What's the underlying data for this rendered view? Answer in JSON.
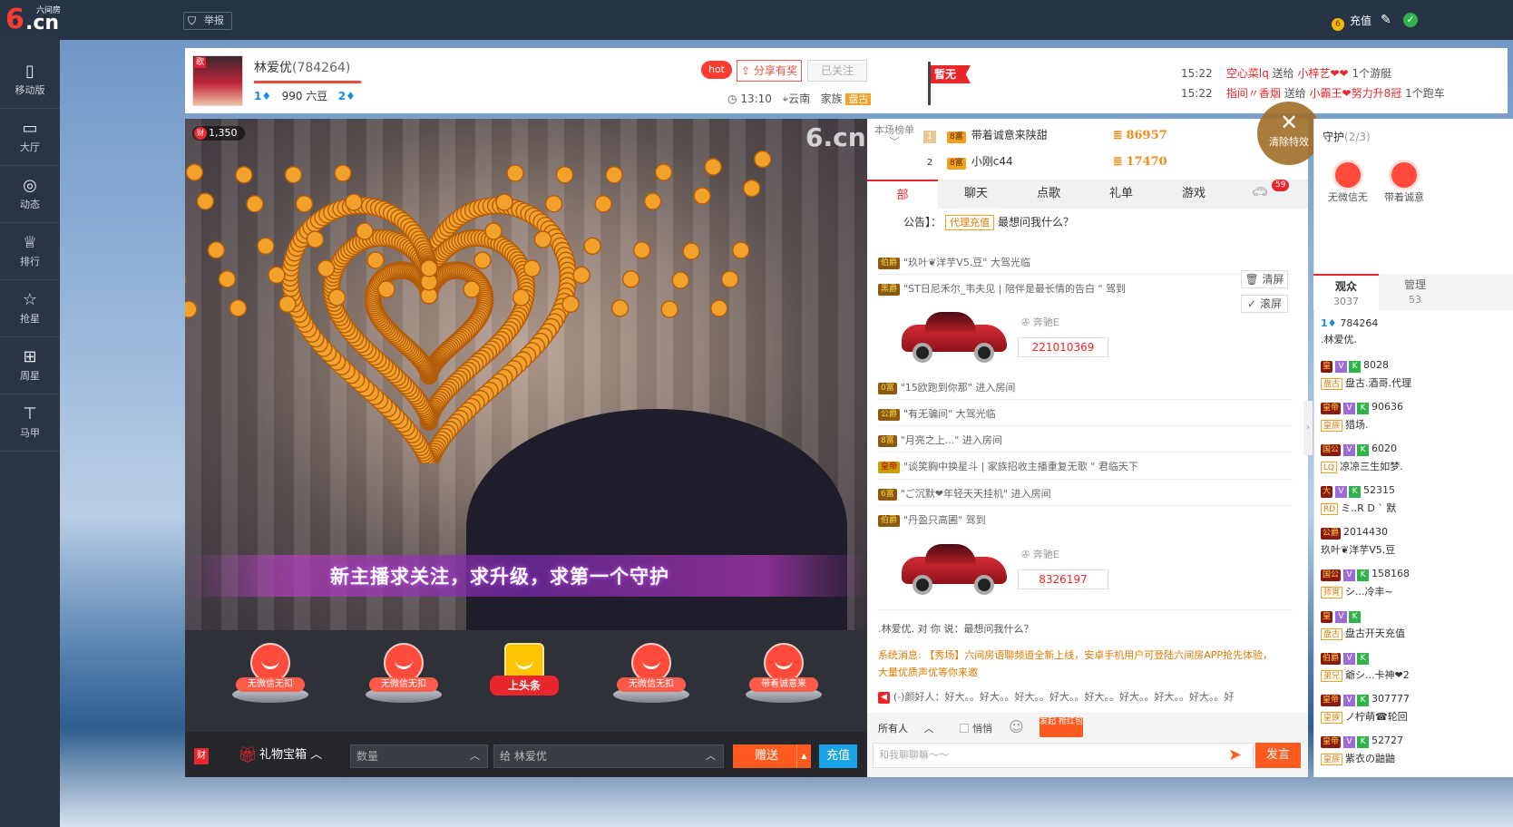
{
  "topbar": {
    "logo_six": "6",
    "logo_cn": ".cn",
    "logo_brand": "六间房",
    "report_label": "举报",
    "recharge_label": "充值"
  },
  "leftnav": [
    {
      "label": "移动版",
      "icon": "phone-icon",
      "glyph": "▯"
    },
    {
      "label": "大厅",
      "icon": "tv-icon",
      "glyph": "▭"
    },
    {
      "label": "动态",
      "icon": "compass-icon",
      "glyph": "◎"
    },
    {
      "label": "排行",
      "icon": "crown-icon",
      "glyph": "♕"
    },
    {
      "label": "抢星",
      "icon": "star-icon",
      "glyph": "☆"
    },
    {
      "label": "周星",
      "icon": "gift-icon",
      "glyph": "⊞"
    },
    {
      "label": "马甲",
      "icon": "shirt-icon",
      "glyph": "⊤"
    }
  ],
  "anchor": {
    "avatar_tag": "歌",
    "name": "林爱优",
    "room_id": "(784264)",
    "level_left": "1",
    "beans": "990 六豆",
    "level_right": "2",
    "hot": "hot",
    "share_label": "分享有奖",
    "follow_label": "已关注",
    "time": "13:10",
    "location": "云南",
    "family_label": "家族",
    "family_tag": "盘古"
  },
  "flag_label": "暂无",
  "notices": [
    {
      "time": "15:22",
      "from": "空心菜lq",
      "verb": "送给",
      "to": "小梓艺❤❤",
      "gift": "1个游艇"
    },
    {
      "time": "15:22",
      "from": "指间〃香烟",
      "verb": "送给",
      "to": "小霸王❤努力升8冠",
      "gift": "1个跑车"
    }
  ],
  "video": {
    "coin_count": "1,350",
    "watermark": "6.cn",
    "banner_text": "新主播求关注，求升级，求第一个守护"
  },
  "gifts": [
    {
      "label": "无微信无扣"
    },
    {
      "label": "无微信无扣"
    },
    {
      "label": "上头条"
    },
    {
      "label": "无微信无扣"
    },
    {
      "label": "带着诚意来"
    }
  ],
  "bottombar": {
    "wealth_icon": "财",
    "gift_box_label": "礼物宝箱",
    "qty_placeholder": "数量",
    "to_label": "给 林爱优",
    "give_label": "赠送",
    "recharge_label": "充值"
  },
  "rank": {
    "title": "本场榜单",
    "rows": [
      {
        "num": "1",
        "lv": "8富",
        "name": "带着诚意来陕甜",
        "score": "86957"
      },
      {
        "num": "2",
        "lv": "8富",
        "name": "小刚c44",
        "score": "17470"
      }
    ]
  },
  "clear_fx_label": "清除特效",
  "chat_tabs": [
    "聊天",
    "点歌",
    "礼单",
    "游戏"
  ],
  "car_count": "59",
  "announce": {
    "prefix": "公告】：",
    "agent": "代理充值",
    "text": "最想问我什么？"
  },
  "messages": [
    {
      "badge": "伯爵",
      "text": "\"玖叶❦洋芋V5.豆\" 大驾光临"
    },
    {
      "badge": "黑爵",
      "text": "\"ST日尼禾尔_韦夫见 | 陪伴是最长情的告白 \" 驾到"
    },
    {
      "badge": "0富",
      "text": "\"15欧跑到你那\" 进入房间"
    },
    {
      "badge": "公爵",
      "text": "\"有无骗间\" 大驾光临"
    },
    {
      "badge": "8富",
      "text": "\"月亮之上...\" 进入房间"
    },
    {
      "badge": "皇帝",
      "text": "\"谈笑胸中换星斗 | 家族招收主播重复无歌 \" 君临天下"
    },
    {
      "badge": "6富",
      "text": "\"ご沉默❤年轻天天挂机\" 进入房间"
    },
    {
      "badge": "伯爵",
      "text": "\"丹盈只高圃\" 驾到"
    }
  ],
  "car_entries": [
    {
      "brand": "奔驰E",
      "id": "221010369"
    },
    {
      "brand": "奔驰E",
      "id": "8326197"
    }
  ],
  "side_buttons": {
    "clear": "清屏",
    "scroll": "滚屏"
  },
  "chat_bottom": {
    "reply": ".林爱优. 对 你 说：最想问我什么？",
    "system": "系统消息: 【秀场】六间房语聊频道全新上线，安卓手机用户可登陆六间房APP抢先体验，",
    "system2": "大量优质声优等你来邀",
    "good": "(-)颜好人：好大。。好大。。好大。。好大。。好大。。好大。。好大。。好大。。好"
  },
  "chat_input": {
    "audience": "所有人",
    "whisper": "悄悄",
    "red_pack": "发起 抢红包",
    "placeholder": "和我聊聊嘛～～",
    "send_label": "发言"
  },
  "guard": {
    "title": "守护",
    "count": "(2/3)",
    "items": [
      {
        "label": "无微信无"
      },
      {
        "label": "带着诚意"
      }
    ]
  },
  "viewers_tabs": [
    {
      "label": "观众",
      "count": "3037"
    },
    {
      "label": "管理",
      "count": "53"
    }
  ],
  "viewers": [
    {
      "line1": "784264",
      "line2": ".林爱优.",
      "lv": "",
      "v": false,
      "k": false,
      "fam": ""
    },
    {
      "line1": "8028",
      "line2": "盘古.酒哥.代理",
      "lv": "皇",
      "v": true,
      "k": true,
      "fam": "盘古"
    },
    {
      "line1": "90636",
      "line2": "猎场.",
      "lv": "皇帝",
      "v": true,
      "k": true,
      "fam": "皇族"
    },
    {
      "line1": "6020",
      "line2": "凉凉三生如梦.",
      "lv": "国公",
      "v": true,
      "k": true,
      "fam": "LQ"
    },
    {
      "line1": "52315",
      "line2": "ミ..R D ` 默",
      "lv": "大",
      "v": true,
      "k": true,
      "fam": "RD"
    },
    {
      "line1": "2014430",
      "line2": "玖叶❦洋芋V5.豆",
      "lv": "公爵",
      "v": false,
      "k": false,
      "fam": ""
    },
    {
      "line1": "158168",
      "line2": "シ...冷丰~",
      "lv": "国公",
      "v": true,
      "k": true,
      "fam": "师宵"
    },
    {
      "line1": "",
      "line2": "盘古开天充值",
      "lv": "皇",
      "v": true,
      "k": true,
      "fam": "盘古"
    },
    {
      "line1": "",
      "line2": "爺シ...卡神❤2",
      "lv": "伯爵",
      "v": true,
      "k": true,
      "fam": "弟兄"
    },
    {
      "line1": "307777",
      "line2": "ノ柠萌☎轮回",
      "lv": "皇帝",
      "v": true,
      "k": true,
      "fam": "皇族"
    },
    {
      "line1": "52727",
      "line2": "紫衣の鼬鼬",
      "lv": "皇帝",
      "v": true,
      "k": true,
      "fam": "皇族"
    }
  ],
  "colors": {
    "topbar": "#263446",
    "leftnav": "#2b3442",
    "accent_red": "#e8262b",
    "accent_orange": "#ff5a1f",
    "recharge_blue": "#1aa3e8"
  }
}
